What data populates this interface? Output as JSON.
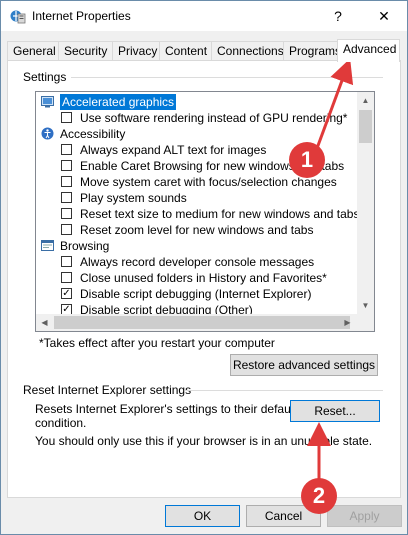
{
  "window": {
    "title": "Internet Properties",
    "help_label": "?",
    "close_label": "✕"
  },
  "tabs": [
    {
      "label": "General"
    },
    {
      "label": "Security"
    },
    {
      "label": "Privacy"
    },
    {
      "label": "Content"
    },
    {
      "label": "Connections"
    },
    {
      "label": "Programs"
    },
    {
      "label": "Advanced",
      "selected": true
    }
  ],
  "settings": {
    "group_title": "Settings",
    "items": [
      {
        "kind": "category",
        "label": "Accelerated graphics",
        "selected": true,
        "icon": "monitor-icon"
      },
      {
        "kind": "option",
        "label": "Use software rendering instead of GPU rendering*",
        "checked": false
      },
      {
        "kind": "category",
        "label": "Accessibility",
        "icon": "accessibility-icon"
      },
      {
        "kind": "option",
        "label": "Always expand ALT text for images",
        "checked": false
      },
      {
        "kind": "option",
        "label": "Enable Caret Browsing for new windows and tabs",
        "checked": false
      },
      {
        "kind": "option",
        "label": "Move system caret with focus/selection changes",
        "checked": false
      },
      {
        "kind": "option",
        "label": "Play system sounds",
        "checked": false
      },
      {
        "kind": "option",
        "label": "Reset text size to medium for new windows and tabs",
        "checked": false
      },
      {
        "kind": "option",
        "label": "Reset zoom level for new windows and tabs",
        "checked": false
      },
      {
        "kind": "category",
        "label": "Browsing",
        "icon": "browsing-icon"
      },
      {
        "kind": "option",
        "label": "Always record developer console messages",
        "checked": false
      },
      {
        "kind": "option",
        "label": "Close unused folders in History and Favorites*",
        "checked": false
      },
      {
        "kind": "option",
        "label": "Disable script debugging (Internet Explorer)",
        "checked": true
      },
      {
        "kind": "option",
        "label": "Disable script debugging (Other)",
        "checked": true
      }
    ],
    "restart_note": "*Takes effect after you restart your computer",
    "restore_label": "Restore advanced settings"
  },
  "reset": {
    "group_title": "Reset Internet Explorer settings",
    "description": "Resets Internet Explorer's settings to their default condition.",
    "description_line1": "Resets Internet Explorer's settings to their default",
    "description_line2": "condition.",
    "button_label": "Reset...",
    "warning": "You should only use this if your browser is in an unusable state."
  },
  "footer": {
    "ok_label": "OK",
    "cancel_label": "Cancel",
    "apply_label": "Apply"
  },
  "annotations": [
    {
      "number": "1"
    },
    {
      "number": "2"
    }
  ],
  "colors": {
    "accent": "#0078d7",
    "marker": "#e03a3a",
    "dialog_bg": "#f0f0f0"
  }
}
